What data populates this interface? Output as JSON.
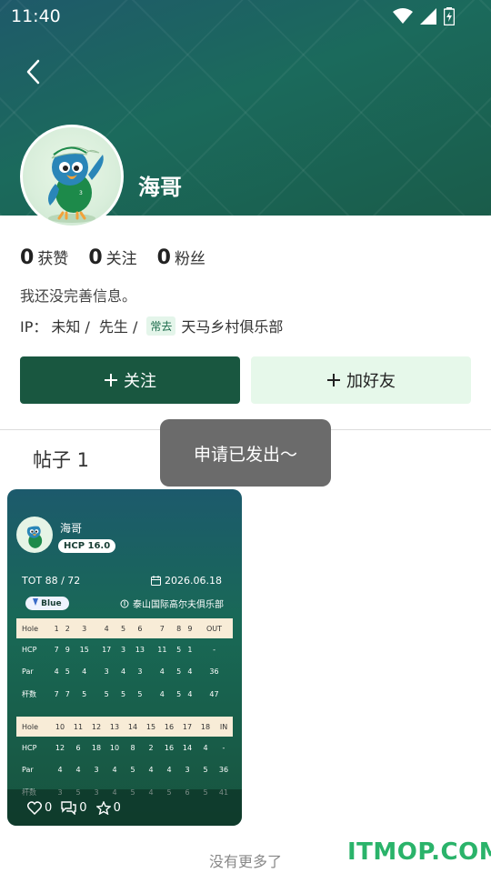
{
  "status": {
    "time": "11:40"
  },
  "profile": {
    "name": "海哥",
    "stats": [
      {
        "num": "0",
        "label": "获赞"
      },
      {
        "num": "0",
        "label": "关注"
      },
      {
        "num": "0",
        "label": "粉丝"
      }
    ],
    "bio": "我还没完善信息。",
    "ip_label": "IP：",
    "ip_value": "未知 /",
    "title": "先生 /",
    "frequent_tag": "常去",
    "club": "天马乡村俱乐部"
  },
  "actions": {
    "follow": "关注",
    "add_friend": "加好友"
  },
  "tabs": {
    "posts": "帖子 1"
  },
  "toast": "申请已发出～",
  "card": {
    "name": "海哥",
    "hcp": "HCP 16.0",
    "tot": "TOT 88 / 72",
    "date": "2026.06.18",
    "tee": "Blue",
    "club": "泰山国际高尔夫俱乐部",
    "front": {
      "head": [
        "Hole",
        "1",
        "2",
        "3",
        "4",
        "5",
        "6",
        "7",
        "8",
        "9",
        "OUT"
      ],
      "rows": [
        [
          "HCP",
          "7",
          "9",
          "15",
          "17",
          "3",
          "13",
          "11",
          "5",
          "1",
          "-"
        ],
        [
          "Par",
          "4",
          "5",
          "4",
          "3",
          "4",
          "3",
          "4",
          "5",
          "4",
          "36"
        ],
        [
          "杆数",
          "7",
          "7",
          "5",
          "5",
          "5",
          "5",
          "4",
          "5",
          "4",
          "47"
        ]
      ]
    },
    "back": {
      "head": [
        "Hole",
        "10",
        "11",
        "12",
        "13",
        "14",
        "15",
        "16",
        "17",
        "18",
        "IN"
      ],
      "rows": [
        [
          "HCP",
          "12",
          "6",
          "18",
          "10",
          "8",
          "2",
          "16",
          "14",
          "4",
          "-"
        ],
        [
          "Par",
          "4",
          "4",
          "3",
          "4",
          "5",
          "4",
          "4",
          "3",
          "5",
          "36"
        ],
        [
          "杆数",
          "3",
          "5",
          "3",
          "4",
          "5",
          "4",
          "5",
          "6",
          "5",
          "41"
        ]
      ]
    },
    "likes": "0",
    "comments": "0",
    "stars": "0"
  },
  "footer": {
    "no_more": "没有更多了"
  },
  "watermark": "ITMOP.COM",
  "colors": {
    "primary": "#195740",
    "accent_light": "#e6f8ea",
    "toast_bg": "#6b6b6b",
    "watermark": "#2ab36a"
  }
}
